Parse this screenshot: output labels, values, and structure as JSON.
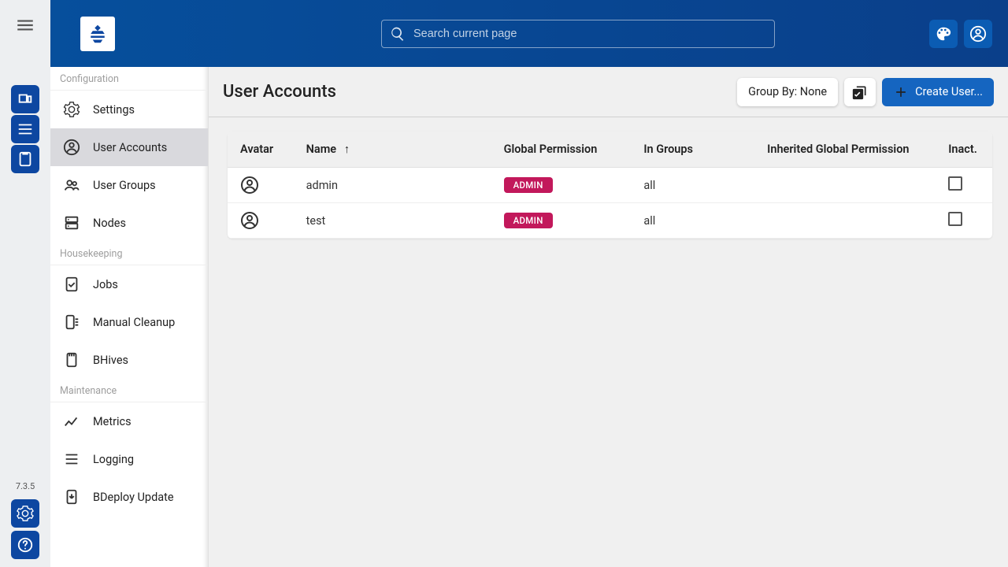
{
  "rail": {
    "version": "7.3.5"
  },
  "topbar": {
    "search_placeholder": "Search current page"
  },
  "sidebar": {
    "sections": [
      {
        "label": "Configuration",
        "items": [
          {
            "id": "settings",
            "label": "Settings",
            "icon": "gear"
          },
          {
            "id": "user-accounts",
            "label": "User Accounts",
            "icon": "account",
            "active": true
          },
          {
            "id": "user-groups",
            "label": "User Groups",
            "icon": "group"
          },
          {
            "id": "nodes",
            "label": "Nodes",
            "icon": "dns"
          }
        ]
      },
      {
        "label": "Housekeeping",
        "items": [
          {
            "id": "jobs",
            "label": "Jobs",
            "icon": "assignment-check"
          },
          {
            "id": "manual-cleanup",
            "label": "Manual Cleanup",
            "icon": "cleanup"
          },
          {
            "id": "bhives",
            "label": "BHives",
            "icon": "sd"
          }
        ]
      },
      {
        "label": "Maintenance",
        "items": [
          {
            "id": "metrics",
            "label": "Metrics",
            "icon": "chart"
          },
          {
            "id": "logging",
            "label": "Logging",
            "icon": "list"
          },
          {
            "id": "bdeploy-update",
            "label": "BDeploy Update",
            "icon": "update"
          }
        ]
      }
    ]
  },
  "page": {
    "title": "User Accounts",
    "group_by_label": "Group By: None",
    "create_label": "Create User..."
  },
  "table": {
    "columns": {
      "avatar": "Avatar",
      "name": "Name",
      "perm": "Global Permission",
      "groups": "In Groups",
      "inherited": "Inherited Global Permission",
      "inact": "Inact."
    },
    "sort_column": "name",
    "sort_dir": "asc",
    "rows": [
      {
        "name": "admin",
        "perm": "ADMIN",
        "groups": "all",
        "inherited": "",
        "inact": false
      },
      {
        "name": "test",
        "perm": "ADMIN",
        "groups": "all",
        "inherited": "",
        "inact": false
      }
    ]
  },
  "colors": {
    "brand": "#0d47a1",
    "primary": "#1565c0",
    "badge": "#c2185b"
  }
}
